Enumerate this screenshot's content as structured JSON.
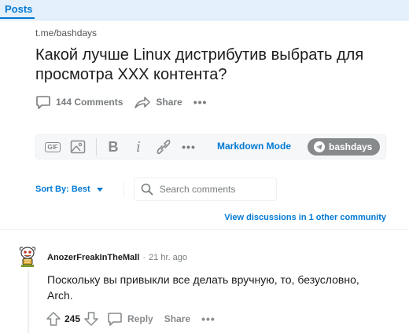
{
  "topbar": {
    "tab_label": "Posts"
  },
  "post": {
    "source": "t.me/bashdays",
    "title": "Какой лучше Linux дистрибутив выбрать для просмотра XXX контента?",
    "comments_label": "144 Comments",
    "share_label": "Share",
    "more_label": "•••"
  },
  "editor": {
    "gif_label": "GIF",
    "bold_label": "B",
    "italic_label": "i",
    "more_label": "•••",
    "markdown_label": "Markdown Mode",
    "channel_label": "bashdays"
  },
  "sort": {
    "label": "Sort By: Best",
    "search_placeholder": "Search comments"
  },
  "discussions_link": "View discussions in 1 other community",
  "comment": {
    "username": "AnozerFreakInTheMall",
    "separator": "·",
    "time": "21 hr. ago",
    "body": "Поскольку вы привыкли все делать вручную, то, безусловно, Arch.",
    "score": "245",
    "reply_label": "Reply",
    "share_label": "Share",
    "more_label": "•••"
  },
  "colors": {
    "accent": "#0079d3",
    "topbar_bg": "#e4f0fb",
    "muted_text": "#787c7e",
    "pill_bg": "#878a8c"
  }
}
